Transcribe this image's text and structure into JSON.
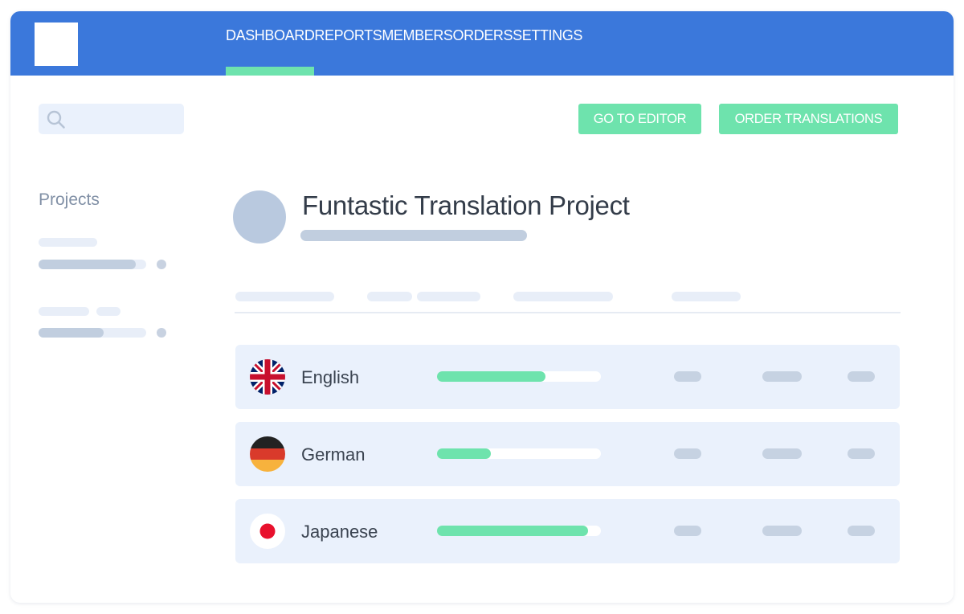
{
  "header": {
    "nav": [
      {
        "label": "DASHBOARD",
        "active": true
      },
      {
        "label": "REPORTS",
        "active": false
      },
      {
        "label": "MEMBERS",
        "active": false
      },
      {
        "label": "ORDERS",
        "active": false
      },
      {
        "label": "SETTINGS",
        "active": false
      }
    ]
  },
  "toolbar": {
    "search_icon": "search-icon",
    "go_to_editor_label": "GO TO EDITOR",
    "order_translations_label": "ORDER TRANSLATIONS"
  },
  "sidebar": {
    "title": "Projects"
  },
  "project": {
    "title": "Funtastic Translation Project"
  },
  "languages": [
    {
      "name": "English",
      "flag": "uk-flag-icon",
      "progress": 0.66
    },
    {
      "name": "German",
      "flag": "germany-flag-icon",
      "progress": 0.33
    },
    {
      "name": "Japanese",
      "flag": "japan-flag-icon",
      "progress": 0.92
    }
  ],
  "colors": {
    "header": "#3b78db",
    "accent": "#6ee3ad",
    "row_background": "#eaf1fc"
  }
}
